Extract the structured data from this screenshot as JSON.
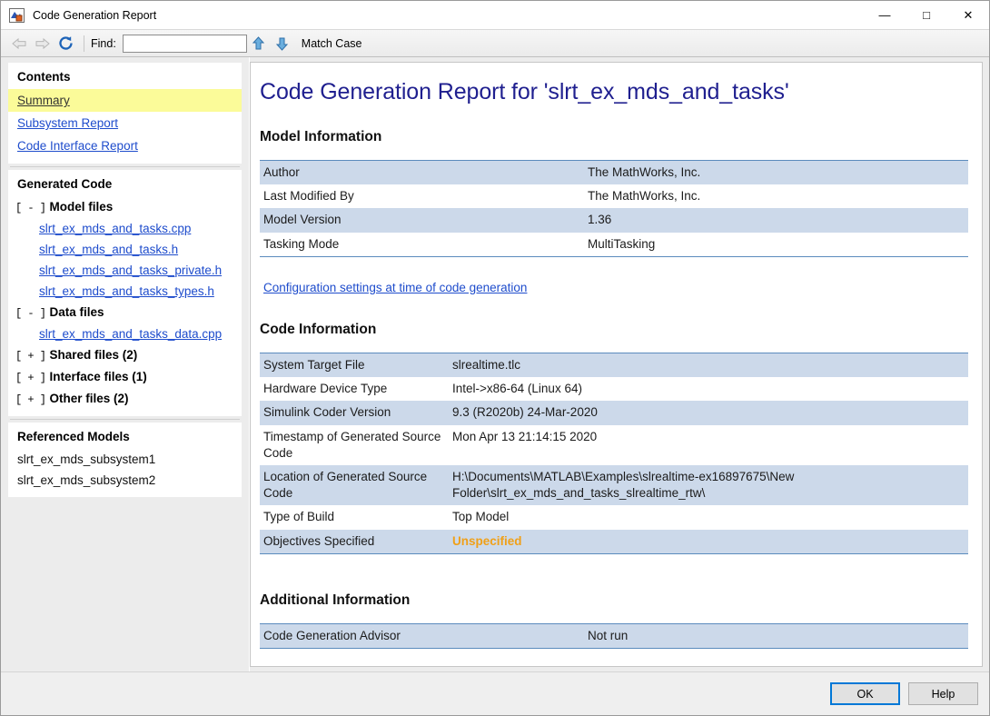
{
  "window": {
    "title": "Code Generation Report",
    "icon": "report-window-icon",
    "controls": {
      "minimize": "—",
      "maximize": "□",
      "close": "✕"
    }
  },
  "toolbar": {
    "back_icon": "back-arrow-icon",
    "forward_icon": "forward-arrow-icon",
    "refresh_icon": "refresh-icon",
    "find_label": "Find:",
    "find_value": "",
    "find_placeholder": "",
    "find_prev_icon": "up-arrow-icon",
    "find_next_icon": "down-arrow-icon",
    "match_case_label": "Match Case"
  },
  "sidebar": {
    "contents": {
      "heading": "Contents",
      "links": [
        {
          "label": "Summary",
          "active": true
        },
        {
          "label": "Subsystem Report",
          "active": false
        },
        {
          "label": "Code Interface Report",
          "active": false
        }
      ]
    },
    "generated_code": {
      "heading": "Generated Code",
      "groups": [
        {
          "marker": "[ - ]",
          "label": "Model files",
          "files": [
            "slrt_ex_mds_and_tasks.cpp",
            "slrt_ex_mds_and_tasks.h",
            "slrt_ex_mds_and_tasks_private.h",
            "slrt_ex_mds_and_tasks_types.h"
          ]
        },
        {
          "marker": "[ - ]",
          "label": "Data files",
          "files": [
            "slrt_ex_mds_and_tasks_data.cpp"
          ]
        },
        {
          "marker": "[ + ]",
          "label": "Shared files (2)",
          "files": []
        },
        {
          "marker": "[ + ]",
          "label": "Interface files (1)",
          "files": []
        },
        {
          "marker": "[ + ]",
          "label": "Other files (2)",
          "files": []
        }
      ]
    },
    "referenced_models": {
      "heading": "Referenced Models",
      "items": [
        "slrt_ex_mds_subsystem1",
        "slrt_ex_mds_subsystem2"
      ]
    }
  },
  "report": {
    "title": "Code Generation Report for 'slrt_ex_mds_and_tasks'",
    "model_information": {
      "heading": "Model Information",
      "rows": [
        {
          "key": "Author",
          "value": "The MathWorks, Inc."
        },
        {
          "key": "Last Modified By",
          "value": "The MathWorks, Inc."
        },
        {
          "key": "Model Version",
          "value": "1.36"
        },
        {
          "key": "Tasking Mode",
          "value": "MultiTasking"
        }
      ]
    },
    "config_link": "Configuration settings at time of code generation",
    "code_information": {
      "heading": "Code Information",
      "rows": [
        {
          "key": "System Target File",
          "value": "slrealtime.tlc",
          "style": ""
        },
        {
          "key": "Hardware Device Type",
          "value": "Intel->x86-64 (Linux 64)",
          "style": ""
        },
        {
          "key": "Simulink Coder Version",
          "value": "9.3 (R2020b) 24-Mar-2020",
          "style": ""
        },
        {
          "key": "Timestamp of Generated Source Code",
          "value": "Mon Apr 13 21:14:15 2020",
          "style": ""
        },
        {
          "key": "Location of Generated Source Code",
          "value": "H:\\Documents\\MATLAB\\Examples\\slrealtime-ex16897675\\New Folder\\slrt_ex_mds_and_tasks_slrealtime_rtw\\",
          "style": ""
        },
        {
          "key": "Type of Build",
          "value": "Top Model",
          "style": ""
        },
        {
          "key": "Objectives Specified",
          "value": "Unspecified",
          "style": "orange"
        }
      ]
    },
    "additional_information": {
      "heading": "Additional Information",
      "rows": [
        {
          "key": "Code Generation Advisor",
          "value": "Not run"
        }
      ]
    }
  },
  "footer": {
    "ok_label": "OK",
    "help_label": "Help"
  },
  "colors": {
    "table_alt_row": "#ccd9ea",
    "table_border": "#5b8bbd",
    "link": "#1e4ccc",
    "title": "#1f1f8f",
    "highlight": "#fbfb99",
    "warning": "#f0a018",
    "accent": "#0078d7"
  }
}
